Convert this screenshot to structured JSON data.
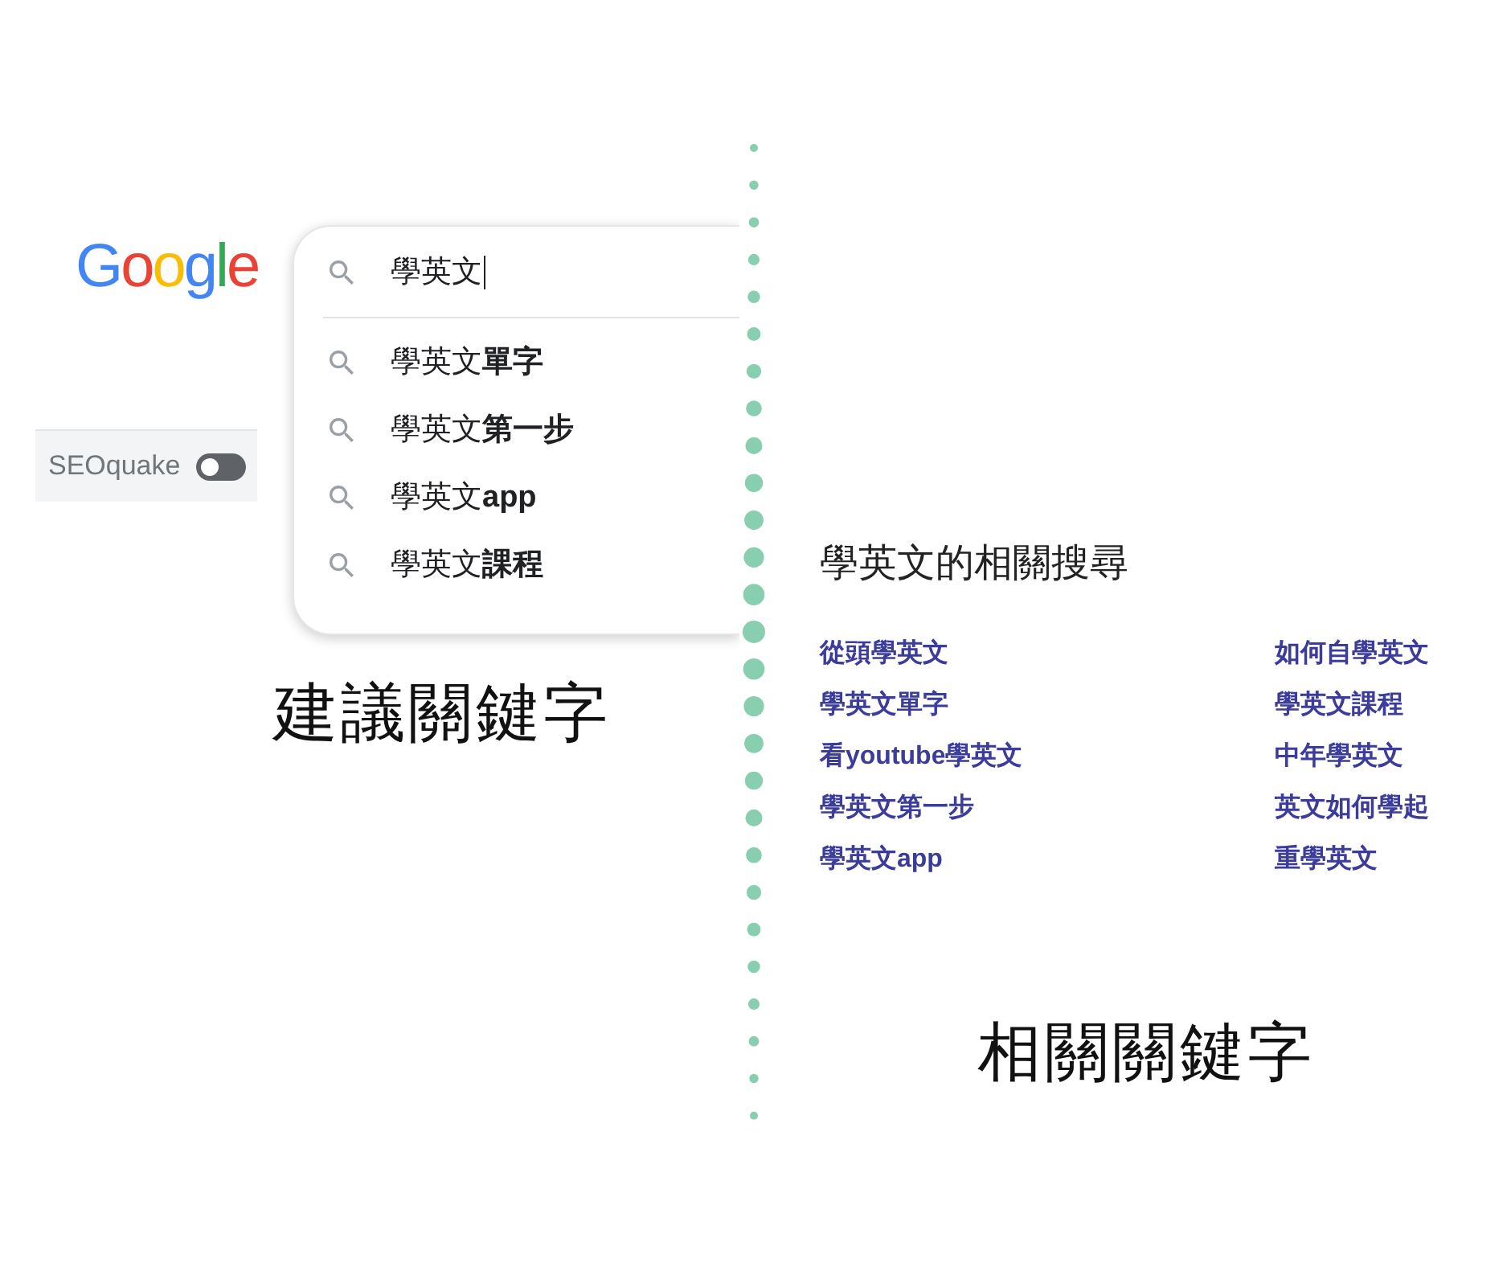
{
  "search_panel": {
    "logo": "Google",
    "query": "學英文",
    "suggestions": [
      "學英文**單字**",
      "學英文**第一步**",
      "學英文**app**",
      "學英文**課程**"
    ],
    "seoquake": {
      "label": "SEOquake",
      "on": false
    },
    "caption": "建議關鍵字"
  },
  "related_panel": {
    "title": "學英文的相關搜尋",
    "columns": [
      [
        "從頭學英文",
        "學英文單字",
        "看youtube學英文",
        "學英文第一步",
        "學英文app"
      ],
      [
        "如何自學英文",
        "學英文課程",
        "中年學英文",
        "英文如何學起",
        "重學英文"
      ]
    ],
    "caption": "相關關鍵字"
  }
}
